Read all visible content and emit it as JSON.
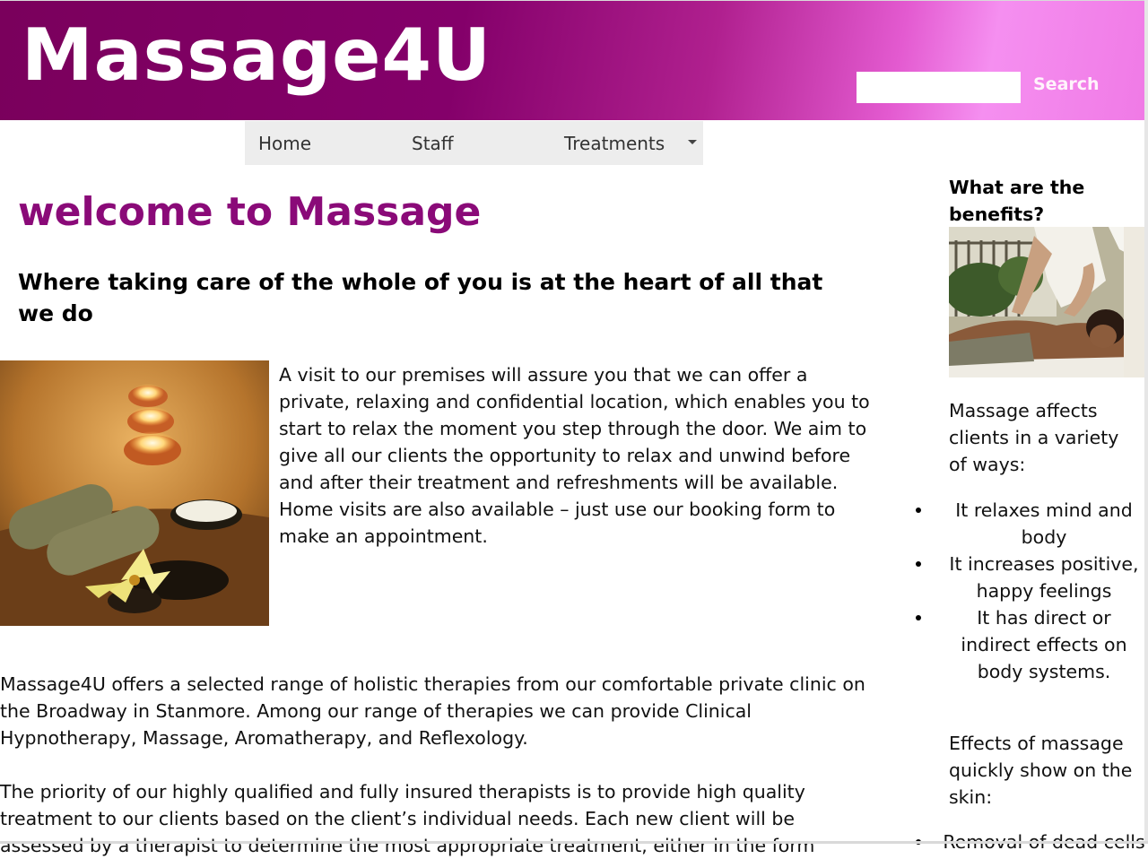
{
  "header": {
    "logo_text": "Massage4U",
    "search": {
      "placeholder": "",
      "value": "",
      "button_label": "Search"
    },
    "colors": {
      "brand": "#8a0a78",
      "gradient_end": "#f07ae6"
    }
  },
  "nav": {
    "items": [
      {
        "label": "Home"
      },
      {
        "label": "Staff"
      },
      {
        "label": "Treatments",
        "icon": "caret-down-icon"
      }
    ]
  },
  "main": {
    "title": "welcome to Massage",
    "subtitle": "Where taking care of the whole of you is at the heart of all that we do",
    "intro": "A visit to our premises will assure you that we can offer a private, relaxing and confidential location, which enables you to start to relax the moment you step through the door. We aim to give all our clients the opportunity to relax and unwind before and after their treatment and refreshments will be available. Home visits are also available – just use our booking form to make an appointment.",
    "paragraph_1": "Massage4U offers a selected range of holistic therapies from our comfortable private clinic on the Broadway in Stanmore. Among our range of therapies we can provide Clinical Hypnotherapy, Massage, Aromatherapy, and Reflexology.",
    "paragraph_2": "The priority of our highly qualified and fully insured therapists is to provide high quality treatment to our clients based on the client’s individual needs. Each new client will be assessed by a therapist to determine the most appropriate treatment, either in the form"
  },
  "sidebar": {
    "heading": "What are the benefits?",
    "intro": "Massage affects clients in a variety of ways:",
    "benefits": [
      "It relaxes mind and body",
      "It increases positive, happy feelings",
      "It has direct or indirect effects on body systems."
    ],
    "skin_intro": "Effects of massage quickly show on the skin:",
    "skin_effects": [
      "Removal of dead cells"
    ]
  }
}
